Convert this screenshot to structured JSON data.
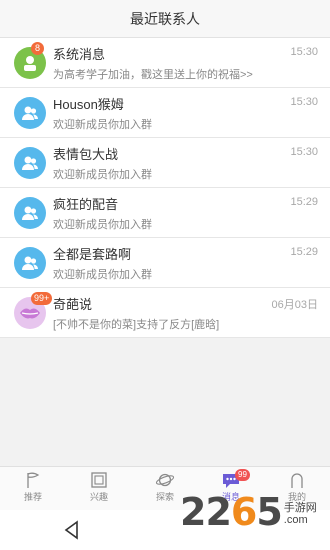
{
  "header": {
    "title": "最近联系人"
  },
  "contacts": [
    {
      "name": "系统消息",
      "preview": "为高考学子加油，戳这里送上你的祝福>>",
      "time": "15:30",
      "badge": "8",
      "avatar": "system-icon"
    },
    {
      "name": "Houson猴姆",
      "preview": "欢迎新成员你加入群",
      "time": "15:30",
      "avatar": "group-icon"
    },
    {
      "name": "表情包大战",
      "preview": "欢迎新成员你加入群",
      "time": "15:30",
      "avatar": "group-icon"
    },
    {
      "name": "疯狂的配音",
      "preview": "欢迎新成员你加入群",
      "time": "15:29",
      "avatar": "group-icon"
    },
    {
      "name": "全都是套路啊",
      "preview": "欢迎新成员你加入群",
      "time": "15:29",
      "avatar": "group-icon"
    },
    {
      "name": "奇葩说",
      "preview": "[不帅不是你的菜]支持了反方[鹿晗]",
      "time": "06月03日",
      "badge": "99+",
      "avatar": "lips-icon"
    }
  ],
  "tabs": [
    {
      "label": "推荐",
      "icon": "flag-icon"
    },
    {
      "label": "兴趣",
      "icon": "square-icon"
    },
    {
      "label": "探索",
      "icon": "planet-icon"
    },
    {
      "label": "消息",
      "icon": "chat-icon",
      "badge": "99",
      "active": true
    },
    {
      "label": "我的",
      "icon": "person-icon"
    }
  ],
  "watermark": {
    "number_a": "22",
    "number_b": "6",
    "number_c": "5",
    "text_top": "手游网",
    "text_bottom": ".com"
  },
  "colors": {
    "accent": "#6b5bd6",
    "group_avatar": "#56b8ec",
    "badge": "#f26b3a"
  }
}
